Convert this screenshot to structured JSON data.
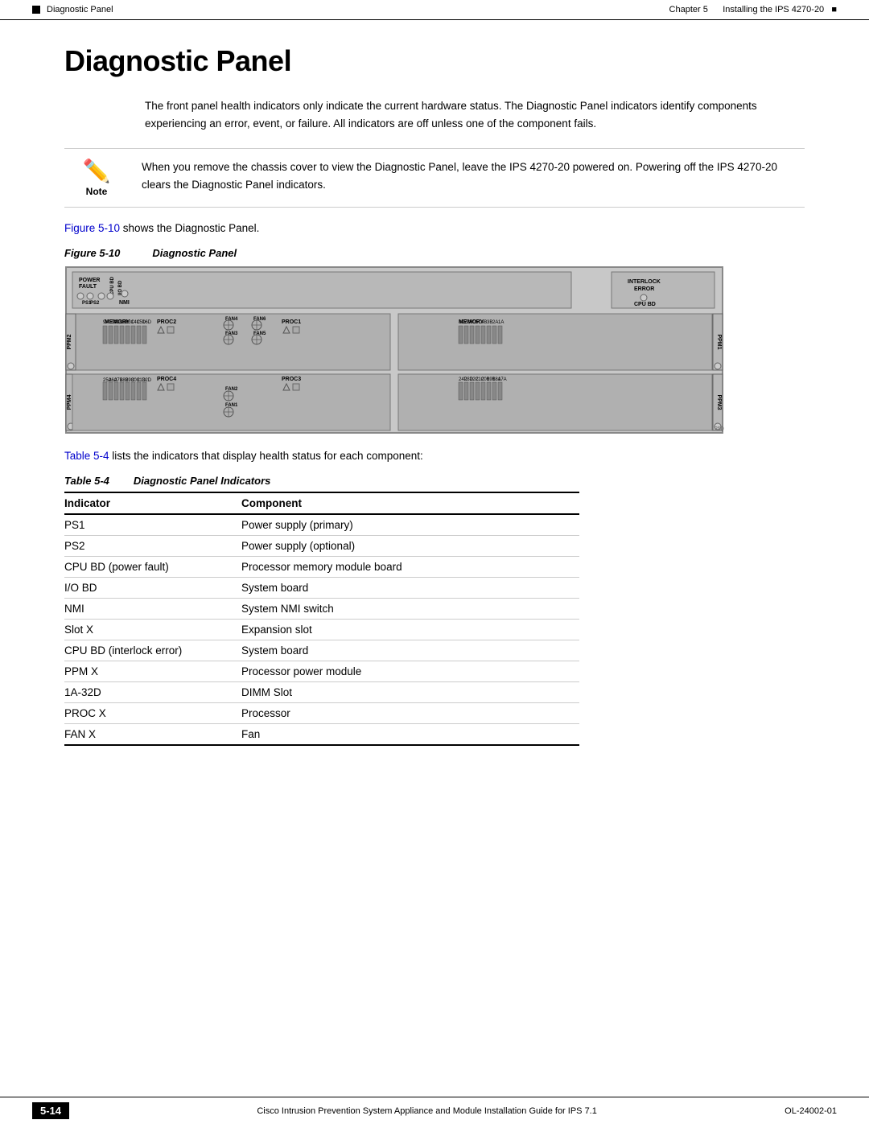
{
  "header": {
    "left_indicator": "■",
    "breadcrumb": "Diagnostic Panel",
    "right_chapter": "Chapter 5",
    "right_title": "Installing the IPS 4270-20"
  },
  "page_title": "Diagnostic Panel",
  "body_text": "The front panel health indicators only indicate the current hardware status. The Diagnostic Panel indicators identify components experiencing an error, event, or failure. All indicators are off unless one of the component fails.",
  "note": {
    "label": "Note",
    "text": "When you remove the chassis cover to view the Diagnostic Panel, leave the IPS 4270-20 powered on. Powering off the IPS 4270-20 clears the Diagnostic Panel indicators."
  },
  "figure_ref": {
    "link": "Figure 5-10",
    "text": " shows the Diagnostic Panel."
  },
  "figure_caption": {
    "num": "Figure 5-10",
    "title": "Diagnostic Panel"
  },
  "table_ref": {
    "link": "Table 5-4",
    "text": " lists the indicators that display health status for each component:"
  },
  "table_caption": {
    "num": "Table       5-4",
    "title": "Diagnostic Panel Indicators"
  },
  "table_headers": [
    "Indicator",
    "Component"
  ],
  "table_rows": [
    [
      "PS1",
      "Power supply (primary)"
    ],
    [
      "PS2",
      "Power supply (optional)"
    ],
    [
      "CPU BD (power fault)",
      "Processor memory module board"
    ],
    [
      "I/O BD",
      "System board"
    ],
    [
      "NMI",
      "System NMI switch"
    ],
    [
      "Slot X",
      "Expansion slot"
    ],
    [
      "CPU BD (interlock error)",
      "System board"
    ],
    [
      "PPM X",
      "Processor power module"
    ],
    [
      "1A-32D",
      "DIMM Slot"
    ],
    [
      "PROC X",
      "Processor"
    ],
    [
      "FAN X",
      "Fan"
    ]
  ],
  "footer": {
    "page_num": "5-14",
    "doc_title": "Cisco Intrusion Prevention System Appliance and Module Installation Guide for IPS 7.1",
    "doc_num": "OL-24002-01"
  },
  "diagram": {
    "watermark": "250250",
    "labels": {
      "power_fault": "POWER\nFAULT",
      "ps1": "PS1",
      "ps2": "PS2",
      "cpu_bd": "CPU BD",
      "io_bd": "I/O BD",
      "nmi": "NMI",
      "interlock": "INTERLOCK\nERROR",
      "cpu_bd2": "CPU BD",
      "memory_top": "MEMORY",
      "memory_bottom": "MEMORY",
      "fan4": "FAN4",
      "fan5": "FAN5",
      "fan6": "FAN6",
      "fan3": "FAN3",
      "fan2": "FAN2",
      "fan1": "FAN1",
      "proc1": "PROC1",
      "proc2": "PROC2",
      "proc3": "PROC3",
      "proc4": "PROC4",
      "ppm1": "PPM1",
      "ppm2": "PPM2",
      "ppm3": "PPM3",
      "ppm4": "PPM4"
    }
  }
}
